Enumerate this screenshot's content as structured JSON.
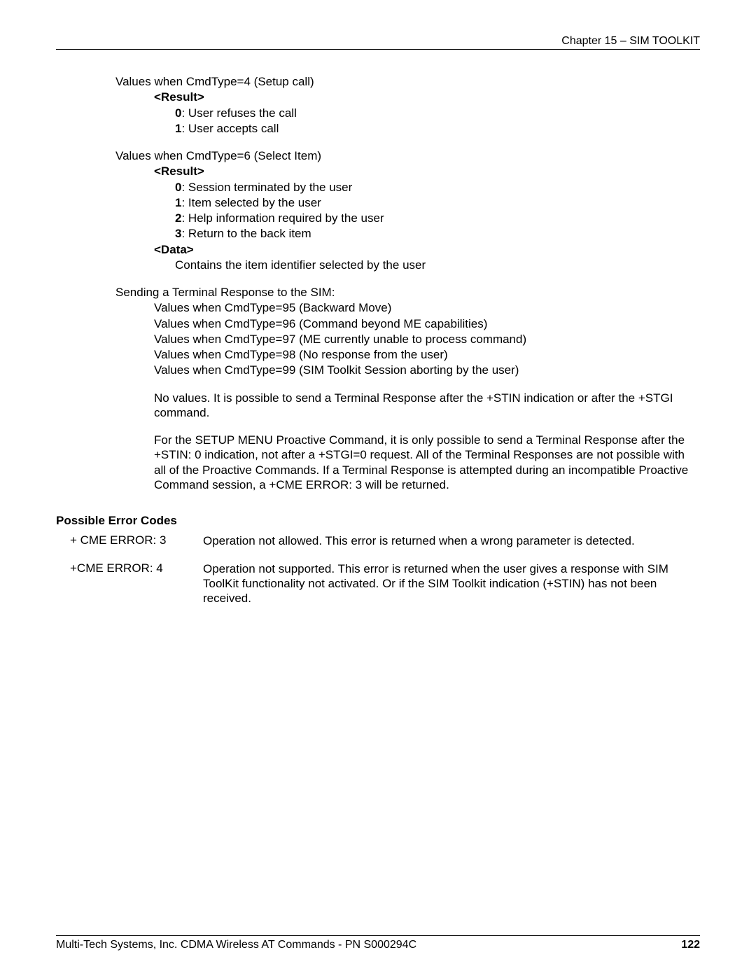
{
  "header": {
    "chapter": "Chapter 15 – SIM TOOLKIT"
  },
  "footer": {
    "left": "Multi-Tech Systems, Inc. CDMA Wireless AT Commands - PN S000294C",
    "page": "122"
  },
  "cmd4": {
    "title": "Values when CmdType=4 (Setup call)",
    "result_label": "<Result>",
    "r0b": "0",
    "r0t": ": User refuses the call",
    "r1b": "1",
    "r1t": ": User accepts call"
  },
  "cmd6": {
    "title": "Values when CmdType=6 (Select Item)",
    "result_label": "<Result>",
    "r0b": "0",
    "r0t": ": Session terminated by the user",
    "r1b": "1",
    "r1t": ": Item selected by the user",
    "r2b": "2",
    "r2t": ": Help information required by the user",
    "r3b": "3",
    "r3t": ": Return to the back item",
    "data_label": "<Data>",
    "data_desc": "Contains the item identifier selected by the user"
  },
  "term": {
    "title": "Sending a Terminal Response to the SIM:",
    "l1": "Values when CmdType=95 (Backward Move)",
    "l2": "Values when CmdType=96 (Command beyond ME capabilities)",
    "l3": "Values when CmdType=97 (ME currently unable to process command)",
    "l4": "Values when CmdType=98 (No response from the user)",
    "l5": "Values when CmdType=99 (SIM Toolkit Session aborting by the user)",
    "p1": "No values. It is possible to send a Terminal Response after the +STIN indication or after the +STGI command.",
    "p2": "For the SETUP MENU Proactive Command, it is only possible to send a Terminal Response after the +STIN: 0 indication, not after a +STGI=0 request. All of the Terminal Responses are not possible with all of the Proactive Commands. If a Terminal Response is attempted during an incompatible Proactive Command session, a +CME ERROR: 3 will be returned."
  },
  "errors": {
    "heading": "Possible Error Codes",
    "e1code": "+ CME ERROR: 3",
    "e1desc": "Operation not allowed. This error is returned when a wrong parameter is detected.",
    "e2code": "+CME ERROR: 4",
    "e2desc": "Operation not supported. This error is returned when the user gives a response with SIM ToolKit functionality not activated. Or if the SIM Toolkit indication (+STIN) has not been received."
  }
}
